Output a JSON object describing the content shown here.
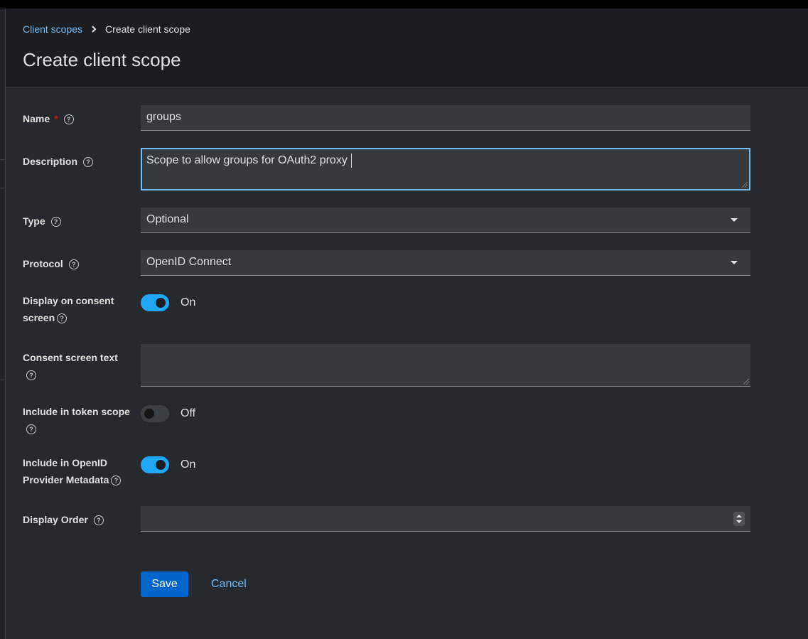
{
  "breadcrumb": {
    "parent": "Client scopes",
    "current": "Create client scope"
  },
  "page_title": "Create client scope",
  "form": {
    "name": {
      "label": "Name",
      "required_marker": "*",
      "value": "groups"
    },
    "description": {
      "label": "Description",
      "value": "Scope to allow groups for OAuth2 proxy"
    },
    "type": {
      "label": "Type",
      "value": "Optional"
    },
    "protocol": {
      "label": "Protocol",
      "value": "OpenID Connect"
    },
    "display_on_consent": {
      "label_line1": "Display on consent",
      "label_line2": "screen",
      "state": "On",
      "enabled": true
    },
    "consent_text": {
      "label": "Consent screen text",
      "value": ""
    },
    "include_token_scope": {
      "label": "Include in token scope",
      "state": "Off",
      "enabled": false
    },
    "include_openid_metadata": {
      "label_line1": "Include in OpenID",
      "label_line2": "Provider Metadata",
      "state": "On",
      "enabled": true
    },
    "display_order": {
      "label": "Display Order",
      "value": ""
    }
  },
  "actions": {
    "save": "Save",
    "cancel": "Cancel"
  },
  "help_glyph": "?",
  "colors": {
    "accent": "#0066cc",
    "link": "#73bcf7",
    "switch_on": "#1fa7f8",
    "required": "#c9190b"
  }
}
